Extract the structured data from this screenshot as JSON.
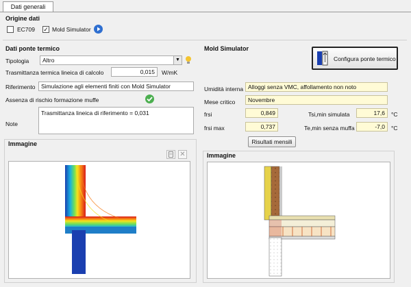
{
  "tab": {
    "label": "Dati generali"
  },
  "origin": {
    "title": "Origine dati",
    "ec709_label": "EC709",
    "ec709_checked": false,
    "mold_label": "Mold Simulator",
    "mold_checked": true
  },
  "left": {
    "title": "Dati ponte termico",
    "tipologia_label": "Tipologia",
    "tipologia_value": "Altro",
    "trasm_label": "Trasmittanza termica lineica di calcolo",
    "trasm_value": "0,015",
    "trasm_unit": "W/mK",
    "rif_label": "Riferimento",
    "rif_value": "Simulazione agli elementi finiti con Mold Simulator",
    "assenza_label": "Assenza di rischio formazione muffe",
    "note_label": "Note",
    "note_value": "Trasmittanza lineica di riferimento = 0,031",
    "image_title": "Immagine"
  },
  "right": {
    "title": "Mold Simulator",
    "config_button": "Configura ponte termico",
    "umid_label": "Umidità interna",
    "umid_value": "Alloggi senza VMC, affollamento non noto",
    "mese_label": "Mese critico",
    "mese_value": "Novembre",
    "frsi_label": "frsi",
    "frsi_value": "0,849",
    "frsimax_label": "frsi max",
    "frsimax_value": "0,737",
    "tsi_label": "Tsi,min simulata",
    "tsi_value": "17,6",
    "te_label": "Te,min senza muffa",
    "te_value": "-7,0",
    "unit_c": "°C",
    "results_button": "Risultati mensili",
    "image_title": "Immagine"
  },
  "colors": {
    "highlight": "#fffbd6",
    "accent_blue": "#2f6fd0",
    "ok_green": "#4caf50"
  }
}
